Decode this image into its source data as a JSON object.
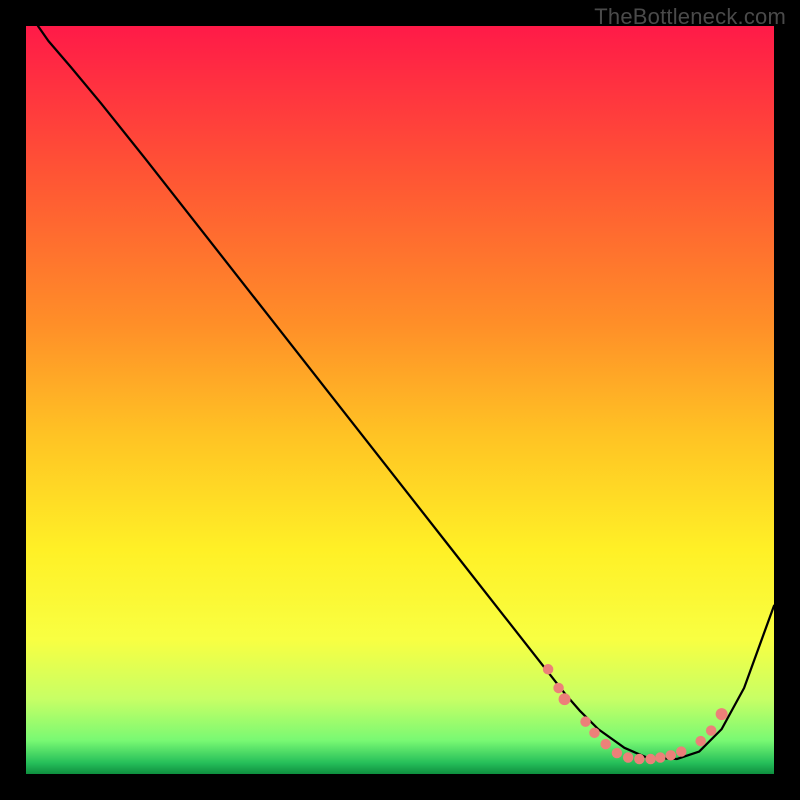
{
  "watermark": {
    "text": "TheBottleneck.com"
  },
  "chart_data": {
    "type": "line",
    "title": "",
    "xlabel": "",
    "ylabel": "",
    "xlim": [
      0,
      1000
    ],
    "ylim": [
      0,
      1000
    ],
    "gradient": {
      "stops": [
        {
          "offset": 0.0,
          "color": "#ff1a48"
        },
        {
          "offset": 0.2,
          "color": "#ff5534"
        },
        {
          "offset": 0.4,
          "color": "#ff8f28"
        },
        {
          "offset": 0.55,
          "color": "#ffc424"
        },
        {
          "offset": 0.7,
          "color": "#fff026"
        },
        {
          "offset": 0.82,
          "color": "#f8ff42"
        },
        {
          "offset": 0.9,
          "color": "#c7ff65"
        },
        {
          "offset": 0.955,
          "color": "#79f973"
        },
        {
          "offset": 0.985,
          "color": "#26bf5a"
        },
        {
          "offset": 1.0,
          "color": "#0e8f3f"
        }
      ]
    },
    "series": [
      {
        "name": "bottleneck-curve",
        "color": "#000000",
        "x": [
          16,
          30,
          60,
          100,
          160,
          240,
          320,
          400,
          480,
          560,
          640,
          695,
          720,
          740,
          765,
          800,
          830,
          870,
          900,
          930,
          960,
          1000
        ],
        "values": [
          1000,
          980,
          945,
          897,
          822,
          720,
          618,
          516,
          414,
          312,
          210,
          140,
          108,
          85,
          60,
          35,
          22,
          20,
          30,
          60,
          115,
          225
        ]
      }
    ],
    "markers": {
      "color": "#ec8079",
      "clusters": [
        {
          "approx_x_range": [
            695,
            730
          ],
          "points": [
            {
              "x": 698,
              "y": 140,
              "r": 7
            },
            {
              "x": 712,
              "y": 115,
              "r": 7
            },
            {
              "x": 720,
              "y": 100,
              "r": 8
            }
          ]
        },
        {
          "approx_x_range": [
            740,
            880
          ],
          "points": [
            {
              "x": 748,
              "y": 70,
              "r": 7
            },
            {
              "x": 760,
              "y": 55,
              "r": 7
            },
            {
              "x": 775,
              "y": 40,
              "r": 7
            },
            {
              "x": 790,
              "y": 28,
              "r": 7
            },
            {
              "x": 805,
              "y": 22,
              "r": 7
            },
            {
              "x": 820,
              "y": 20,
              "r": 7
            },
            {
              "x": 835,
              "y": 20,
              "r": 7
            },
            {
              "x": 848,
              "y": 22,
              "r": 7
            },
            {
              "x": 862,
              "y": 25,
              "r": 7
            },
            {
              "x": 876,
              "y": 30,
              "r": 7
            }
          ]
        },
        {
          "approx_x_range": [
            895,
            935
          ],
          "points": [
            {
              "x": 902,
              "y": 44,
              "r": 7
            },
            {
              "x": 916,
              "y": 58,
              "r": 7
            },
            {
              "x": 930,
              "y": 80,
              "r": 8
            }
          ]
        }
      ]
    }
  }
}
